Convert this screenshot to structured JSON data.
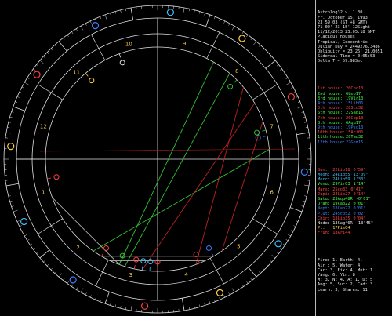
{
  "header": {
    "lines": [
      "Astrolog32 v. 1.30",
      "Fr. October 15, 1993",
      "23 59 03 (ST +8 GMT)",
      "71 00' 23 15' 12Sight",
      "11/12/2013 23:05:18 GMT",
      "Placidus houses",
      "Tropical, Geocentric",
      "Julian Day = 2449276.3486",
      "Obliquity = 23 26' 21.0051",
      "Sidereal Time = 0:05:53",
      "Delta T = 59.98Sec"
    ]
  },
  "houses": [
    {
      "label": "1st house:",
      "value": "20Cnc13",
      "color": "#ff4040"
    },
    {
      "label": "2nd house:",
      "value": "6Leo17",
      "color": "#40ff40"
    },
    {
      "label": "3rd house:",
      "value": "19Vir13",
      "color": "#40ff40"
    },
    {
      "label": "4th house:",
      "value": "15Lib06",
      "color": "#4080ff"
    },
    {
      "label": "5th house:",
      "value": "28Sco32",
      "color": "#ff4040"
    },
    {
      "label": "6th house:",
      "value": "27Sag15",
      "color": "#40ff40"
    },
    {
      "label": "7th house:",
      "value": "20Cap13",
      "color": "#ff4040"
    },
    {
      "label": "8th house:",
      "value": "6Aqu17",
      "color": "#40ff40"
    },
    {
      "label": "9th house:",
      "value": "19Psc13",
      "color": "#4080ff"
    },
    {
      "label": "10th house:",
      "value": "15Ari06",
      "color": "#ff4040"
    },
    {
      "label": "11th house:",
      "value": "28Tau32",
      "color": "#40ff40"
    },
    {
      "label": "12th house:",
      "value": "27Gem15",
      "color": "#4080ff"
    }
  ],
  "planets": [
    {
      "name": "Sun:",
      "pos": "22Lib18",
      "speed": "0'59\"",
      "color": "#ff4040"
    },
    {
      "name": "Moon:",
      "pos": "24Lib55",
      "speed": "13'09\"",
      "color": "#40c0ff"
    },
    {
      "name": "Merc:",
      "pos": "24Lib59",
      "speed": "1'33\"",
      "color": "#40c0ff"
    },
    {
      "name": "Venu:",
      "pos": "29Vir03",
      "speed": "1'14\"",
      "color": "#40ff40"
    },
    {
      "name": "Mars:",
      "pos": "2Sco33",
      "speed": "0'41\"",
      "color": "#ff4040"
    },
    {
      "name": "Jupi:",
      "pos": "24Lib27",
      "speed": "0'14\"",
      "color": "#ff4040"
    },
    {
      "name": "Satu:",
      "pos": "23Aqu48R",
      "speed": "-0'01\"",
      "color": "#40ff40"
    },
    {
      "name": "Uran:",
      "pos": "19Cap22",
      "speed": "0'01\"",
      "color": "#40ff40"
    },
    {
      "name": "Nept:",
      "pos": "18Cap22",
      "speed": "0'01\"",
      "color": "#4080ff"
    },
    {
      "name": "Plut:",
      "pos": "24Sco52",
      "speed": "0'02\"",
      "color": "#4080ff"
    },
    {
      "name": "Chir:",
      "pos": "18Lib35",
      "speed": "0'04\"",
      "color": "#ff4040"
    },
    {
      "name": "Node:",
      "pos": "13Sag46R",
      "speed": "-13'45\"",
      "color": "#e8e8e8"
    },
    {
      "name": "Pt:",
      "pos": "17Pis04",
      "speed": "",
      "color": "#ffd040"
    },
    {
      "name": "Fruh:",
      "pos": "18Ari44",
      "speed": "",
      "color": "#ff4040"
    }
  ],
  "summary": [
    "Fire: 1, Earth: 4,",
    "Air : 5, Water: 4",
    "Car: 3, Fix: 4, Mut: 1",
    "Yang: 6, Yin: 8",
    "M: 3, N: 4, A: 1, D: 5",
    "Ang: 5, Suc: 2, Cad: 3",
    "Learn: 3, Shares: 11"
  ],
  "house_numbers": [
    "1",
    "2",
    "3",
    "4",
    "5",
    "6",
    "7",
    "8",
    "9",
    "10",
    "11",
    "12"
  ],
  "zodiac_signs": [
    "aries",
    "taurus",
    "gemini",
    "cancer",
    "leo",
    "virgo",
    "libra",
    "scorpio",
    "sagittarius",
    "capricorn",
    "aquarius",
    "pisces"
  ],
  "colors": {
    "background": "#000000",
    "ring": "#e0e0e0",
    "fire": "#ff4040",
    "earth": "#ffd040",
    "air": "#40c0ff",
    "water": "#4080ff",
    "aspect_green": "#30c030",
    "aspect_red": "#c02020",
    "aspect_grey": "#b0b0b0"
  }
}
